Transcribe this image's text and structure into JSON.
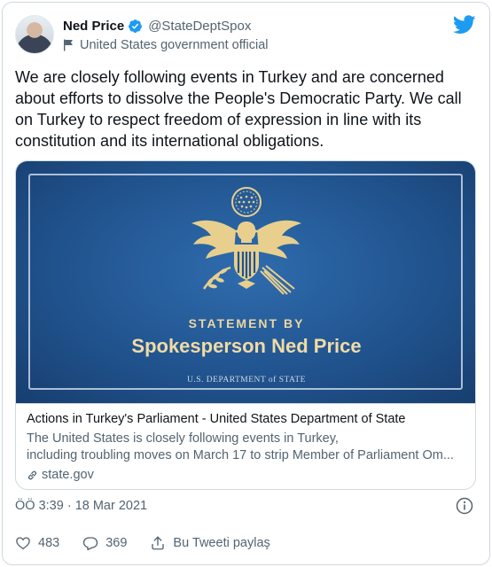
{
  "author": {
    "name": "Ned Price",
    "handle": "@StateDeptSpox",
    "label": "United States government official"
  },
  "tweet": {
    "text": "We are closely following events in Turkey and are concerned about efforts to dissolve the People's Democratic Party. We call on Turkey to respect freedom of expression in line with its constitution and its international obligations.",
    "timestamp": "ÖÖ 3:39 · 18 Mar 2021"
  },
  "card": {
    "image_statement_by": "STATEMENT BY",
    "image_title": "Spokesperson Ned Price",
    "image_dept": "U.S. DEPARTMENT of STATE",
    "title": "Actions in Turkey's Parliament - United States Department of State",
    "description_line1": "The United States is closely following events in Turkey,",
    "description_line2": "including troubling moves on March 17 to strip Member of Parliament Om...",
    "domain": "state.gov"
  },
  "actions": {
    "likes": "483",
    "replies": "369",
    "share_label": "Bu Tweeti paylaş"
  },
  "colors": {
    "twitter_blue": "#1d9bf0",
    "secondary_text": "#536471",
    "card_gold": "#f1dba4",
    "card_blue": "#21548f"
  },
  "icons": [
    "verified-badge-icon",
    "flag-icon",
    "twitter-bird-icon",
    "link-icon",
    "info-icon",
    "heart-icon",
    "reply-icon",
    "share-icon"
  ]
}
